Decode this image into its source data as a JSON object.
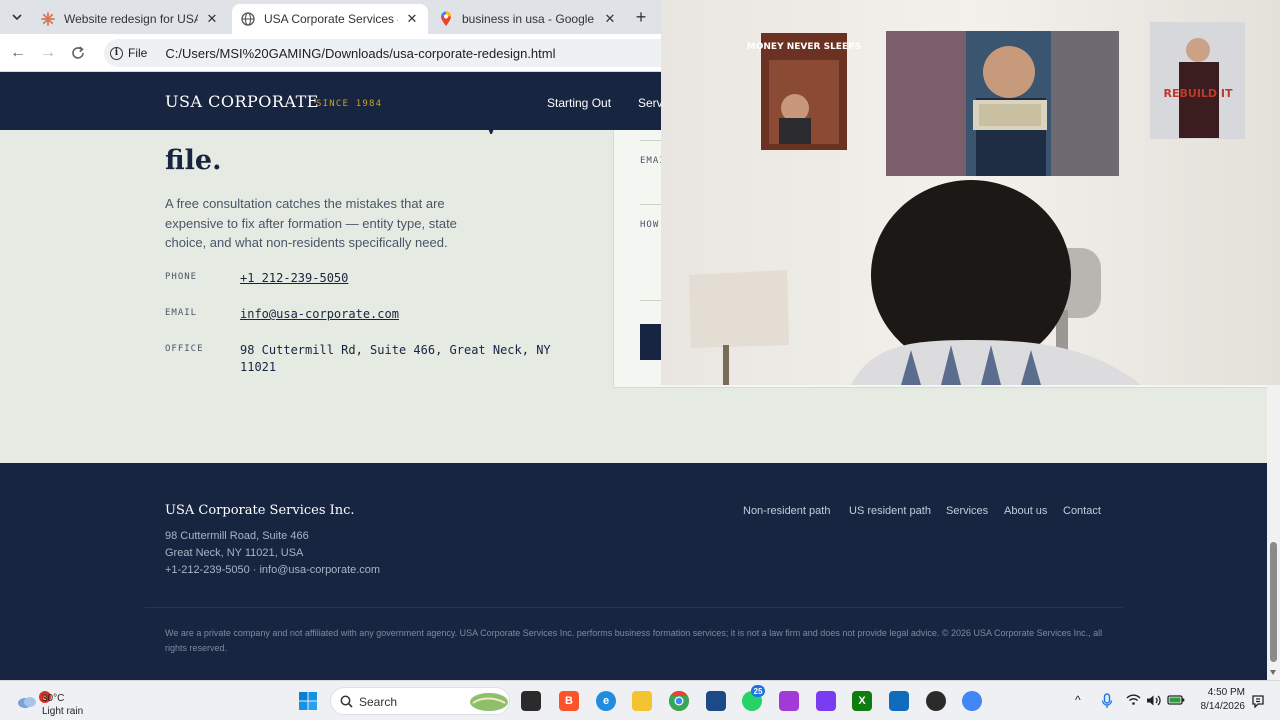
{
  "browser": {
    "tabs": [
      {
        "title": "Website redesign for USA Corp",
        "icon": "claude-icon",
        "active": false
      },
      {
        "title": "USA Corporate Services — We",
        "icon": "globe-icon",
        "active": true
      },
      {
        "title": "business in usa - Google Maps",
        "icon": "maps-pin-icon",
        "active": false
      }
    ],
    "address": {
      "scheme_label": "File",
      "url": "C:/Users/MSI%20GAMING/Downloads/usa-corporate-redesign.html"
    }
  },
  "site": {
    "brand": "USA CORPORATE",
    "since": "SINCE 1984",
    "nav": [
      "Starting Out",
      "Serv"
    ]
  },
  "contact": {
    "heading_tail": "file.",
    "lede": "A free consultation catches the mistakes that are expensive to fix after formation — entity type, state choice, and what non-residents specifically need.",
    "rows": [
      {
        "label": "PHONE",
        "value": "+1 212-239-5050",
        "link": true
      },
      {
        "label": "EMAIL",
        "value": "info@usa-corporate.com",
        "link": true
      },
      {
        "label": "OFFICE",
        "value": "98 Cuttermill Rd, Suite 466, Great Neck, NY 11021",
        "link": false
      }
    ],
    "form_labels": [
      "EMAI",
      "HOW"
    ]
  },
  "footer": {
    "company": "USA Corporate Services Inc.",
    "address_line1": "98 Cuttermill Road, Suite 466",
    "address_line2": "Great Neck, NY 11021, USA",
    "contact_line": "+1-212-239-5050 · info@usa-corporate.com",
    "links": [
      "Non-resident path",
      "US resident path",
      "Services",
      "About us",
      "Contact"
    ],
    "disclaimer": "We are a private company and not affiliated with any government agency. USA Corporate Services Inc. performs business formation services; it is not a law firm and does not provide legal advice. © 2026 USA Corporate Services Inc., all rights reserved."
  },
  "webcam": {
    "poster_left_text": "MONEY NEVER SLEEPS",
    "poster_right_text": "REBUILD IT"
  },
  "taskbar": {
    "weather_badge": "3",
    "temperature": "30°C",
    "condition": "Light rain",
    "search_label": "Search",
    "whatsapp_badge": "25",
    "time": "4:50 PM",
    "date": "8/14/2026"
  },
  "colors": {
    "navy": "#172540",
    "gold": "#c9a227",
    "page_bg": "#e5ebe3"
  }
}
